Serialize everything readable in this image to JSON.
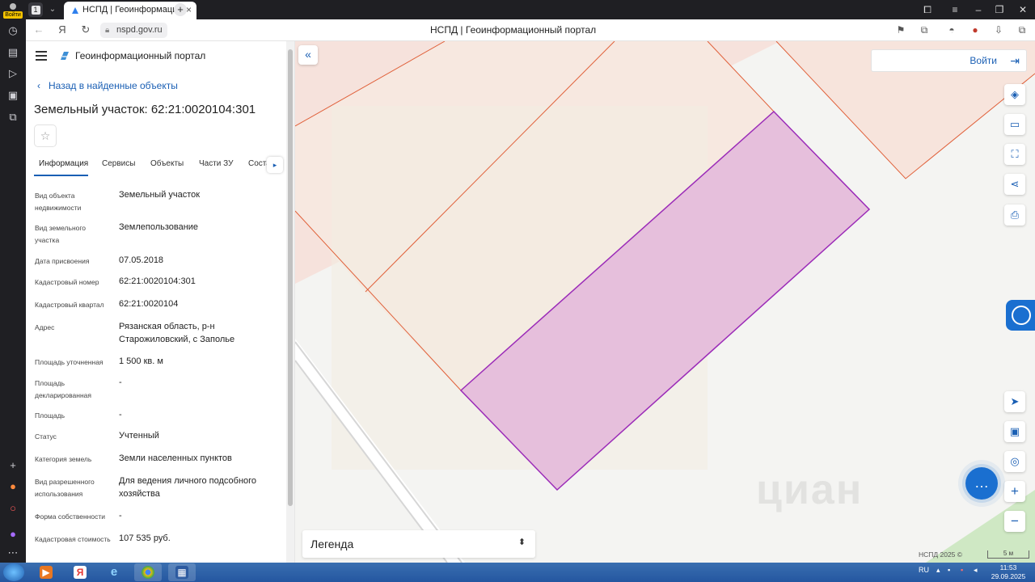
{
  "browser": {
    "profile_label": "Войти",
    "tab_count": "1",
    "tab_title": "НСПД | Геоинформацио",
    "url": "nspd.gov.ru",
    "page_title": "НСПД | Геоинформационный портал"
  },
  "sidebar_panel": {
    "app_name": "Геоинформационный портал",
    "back_link": "Назад в найденные объекты",
    "object_title": "Земельный участок: 62:21:0020104:301",
    "tabs": [
      "Информация",
      "Сервисы",
      "Объекты",
      "Части ЗУ",
      "Соста"
    ],
    "active_tab": "Информация",
    "fields": [
      {
        "label": "Вид объекта недвижимости",
        "value": "Земельный участок"
      },
      {
        "label": "Вид земельного участка",
        "value": "Землепользование"
      },
      {
        "label": "Дата присвоения",
        "value": "07.05.2018"
      },
      {
        "label": "Кадастровый номер",
        "value": "62:21:0020104:301"
      },
      {
        "label": "Кадастровый квартал",
        "value": "62:21:0020104"
      },
      {
        "label": "Адрес",
        "value": "Рязанская область, р-н Старожиловский, с Заполье"
      },
      {
        "label": "Площадь уточненная",
        "value": "1 500 кв. м"
      },
      {
        "label": "Площадь декларированная",
        "value": "-"
      },
      {
        "label": "Площадь",
        "value": "-"
      },
      {
        "label": "Статус",
        "value": "Учтенный"
      },
      {
        "label": "Категория земель",
        "value": "Земли населенных пунктов"
      },
      {
        "label": "Вид разрешенного использования",
        "value": "Для ведения личного подсобного хозяйства"
      },
      {
        "label": "Форма собственности",
        "value": "-"
      },
      {
        "label": "Кадастровая стоимость",
        "value": "107 535 руб."
      }
    ]
  },
  "map": {
    "login_label": "Войти",
    "legend_label": "Легенда",
    "copyright": "НСПД 2025 ©",
    "scale_label": "5 м",
    "watermark": "циан",
    "colors": {
      "parcel_fill": "#e6bfdc",
      "parcel_stroke": "#9b2bb8",
      "neighbor_fill": "#f6e2dc",
      "neighbor_stroke": "#e0603a",
      "accent": "#1a5fb4"
    }
  },
  "taskbar": {
    "lang": "RU",
    "time": "11:53",
    "date": "29.09.2025"
  }
}
